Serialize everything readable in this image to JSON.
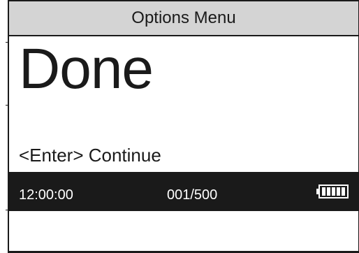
{
  "title_bar": {
    "title": "Options Menu"
  },
  "main": {
    "status_text": "Done",
    "prompt_text": "<Enter> Continue"
  },
  "status_bar": {
    "time": "12:00:00",
    "counter": "001/500",
    "battery_icon": "battery-full-icon",
    "battery_level": 1.0
  },
  "colors": {
    "title_bar_bg": "#d4d4d4",
    "status_bar_bg": "#1a1a1a",
    "text": "#1a1a1a",
    "status_text": "#ffffff"
  }
}
